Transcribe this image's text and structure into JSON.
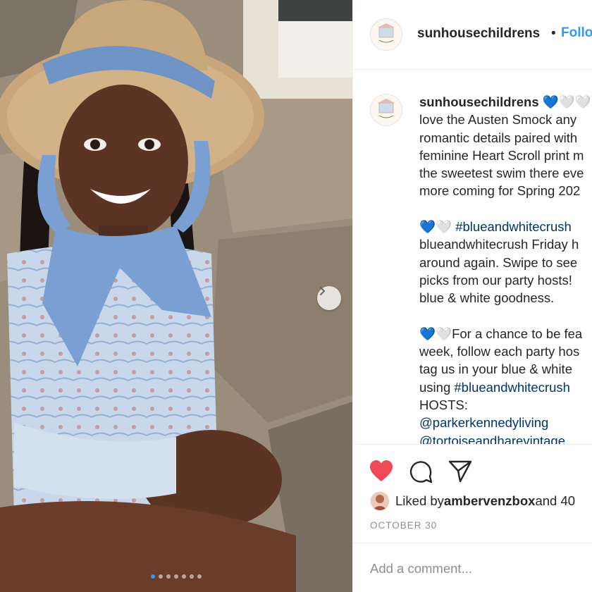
{
  "post": {
    "username": "sunhousechildrens",
    "follow_separator": "•",
    "follow_label": "Follow",
    "caption_lines": [
      [
        "love the Austen Smock any"
      ],
      [
        "romantic details paired with"
      ],
      [
        "feminine Heart Scroll print m"
      ],
      [
        "the sweetest swim there eve"
      ],
      [
        "more coming for Spring 202"
      ]
    ],
    "caption_heart_suffix": "💙🤍🤍",
    "section2_hashtag": "#blueandwhitecrush",
    "section2_lines": [
      "blueandwhitecrush Friday h",
      "around again. Swipe to see",
      "picks from our party hosts!",
      "blue & white goodness."
    ],
    "section3_lines": [
      "For a chance to be fea",
      "week, follow each party hos",
      "tag us in your blue & white "
    ],
    "section3_using": "using ",
    "section3_hashtag": "#blueandwhitecrush",
    "section3_hosts": "HOSTS:",
    "mention_1": "@parkerkennedyliving",
    "mention_2": "@tortoiseandharevintage",
    "liked_prefix": "Liked by ",
    "liked_user": "ambervenzbox",
    "liked_suffix": " and 40",
    "date": "OCTOBER 30",
    "add_comment_placeholder": "Add a comment..."
  },
  "carousel": {
    "slide_count": 7,
    "active_index": 0
  },
  "colors": {
    "accent": "#3897f0",
    "like": "#ed4956",
    "hashtag": "#003569",
    "muted": "#8e8e8e"
  },
  "icons": [
    "chevron-right-icon",
    "heart-icon",
    "comment-icon",
    "share-icon",
    "heart-emoji-icon"
  ]
}
